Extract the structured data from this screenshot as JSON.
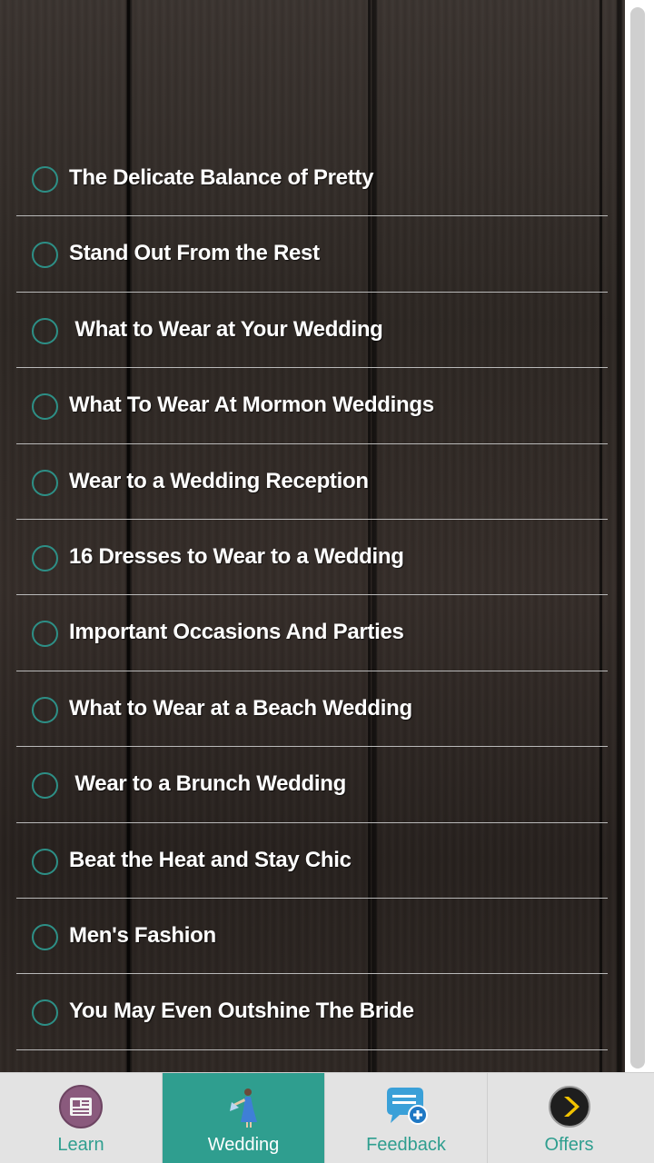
{
  "menu": {
    "items": [
      {
        "label": "The Delicate Balance of Pretty"
      },
      {
        "label": "Stand Out From the Rest"
      },
      {
        "label": " What to Wear at Your Wedding"
      },
      {
        "label": "What To Wear At Mormon Weddings"
      },
      {
        "label": "Wear to a Wedding Reception"
      },
      {
        "label": "16 Dresses to Wear to a Wedding"
      },
      {
        "label": "Important Occasions And Parties"
      },
      {
        "label": "What to Wear at a Beach Wedding"
      },
      {
        "label": " Wear to a Brunch Wedding"
      },
      {
        "label": "Beat the Heat and Stay Chic"
      },
      {
        "label": "Men's Fashion"
      },
      {
        "label": "You May Even Outshine The Bride"
      }
    ]
  },
  "tabs": [
    {
      "label": "Learn",
      "icon": "newspaper-icon"
    },
    {
      "label": "Wedding",
      "icon": "bride-figure-icon",
      "active": true
    },
    {
      "label": "Feedback",
      "icon": "chat-bubble-add-icon"
    },
    {
      "label": "Offers",
      "icon": "chevron-right-circle-icon"
    }
  ],
  "colors": {
    "accent": "#2f9e8f",
    "tabbar_bg": "#e3e3e3",
    "text": "#ffffff"
  }
}
